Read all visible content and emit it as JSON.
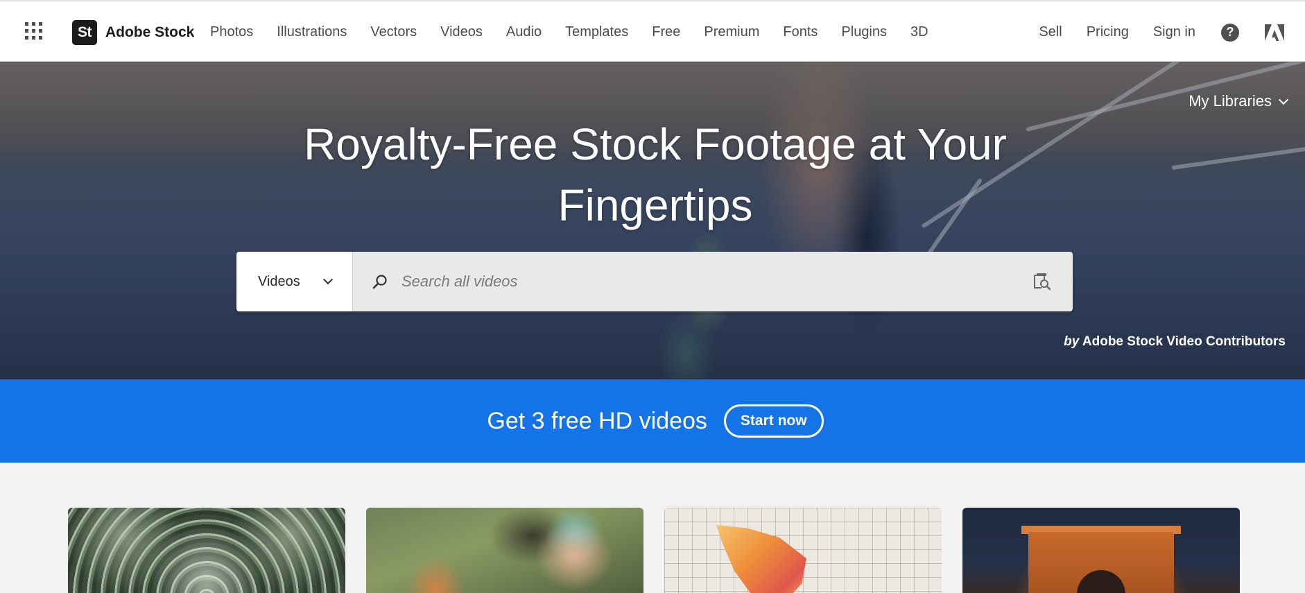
{
  "header": {
    "brand_logo": "St",
    "brand_name": "Adobe Stock",
    "nav": [
      "Photos",
      "Illustrations",
      "Vectors",
      "Videos",
      "Audio",
      "Templates",
      "Free",
      "Premium",
      "Fonts",
      "Plugins",
      "3D"
    ],
    "right_links": [
      "Sell",
      "Pricing",
      "Sign in"
    ],
    "help_glyph": "?",
    "icons": [
      "apps-grid-icon",
      "help-icon",
      "adobe-logo-icon"
    ]
  },
  "hero": {
    "title_line1": "Royalty-Free Stock Footage at Your",
    "title_line2": "Fingertips",
    "my_libraries": "My Libraries",
    "search": {
      "type_selected": "Videos",
      "placeholder": "Search all videos"
    },
    "credit_by": "by",
    "credit_name": "Adobe Stock Video Contributors"
  },
  "promo": {
    "text": "Get 3 free HD videos",
    "button": "Start now"
  },
  "colors": {
    "promo_bg": "#1473e6",
    "brand_dark": "#1b1b1b",
    "nav_text": "#4b4b4b"
  }
}
